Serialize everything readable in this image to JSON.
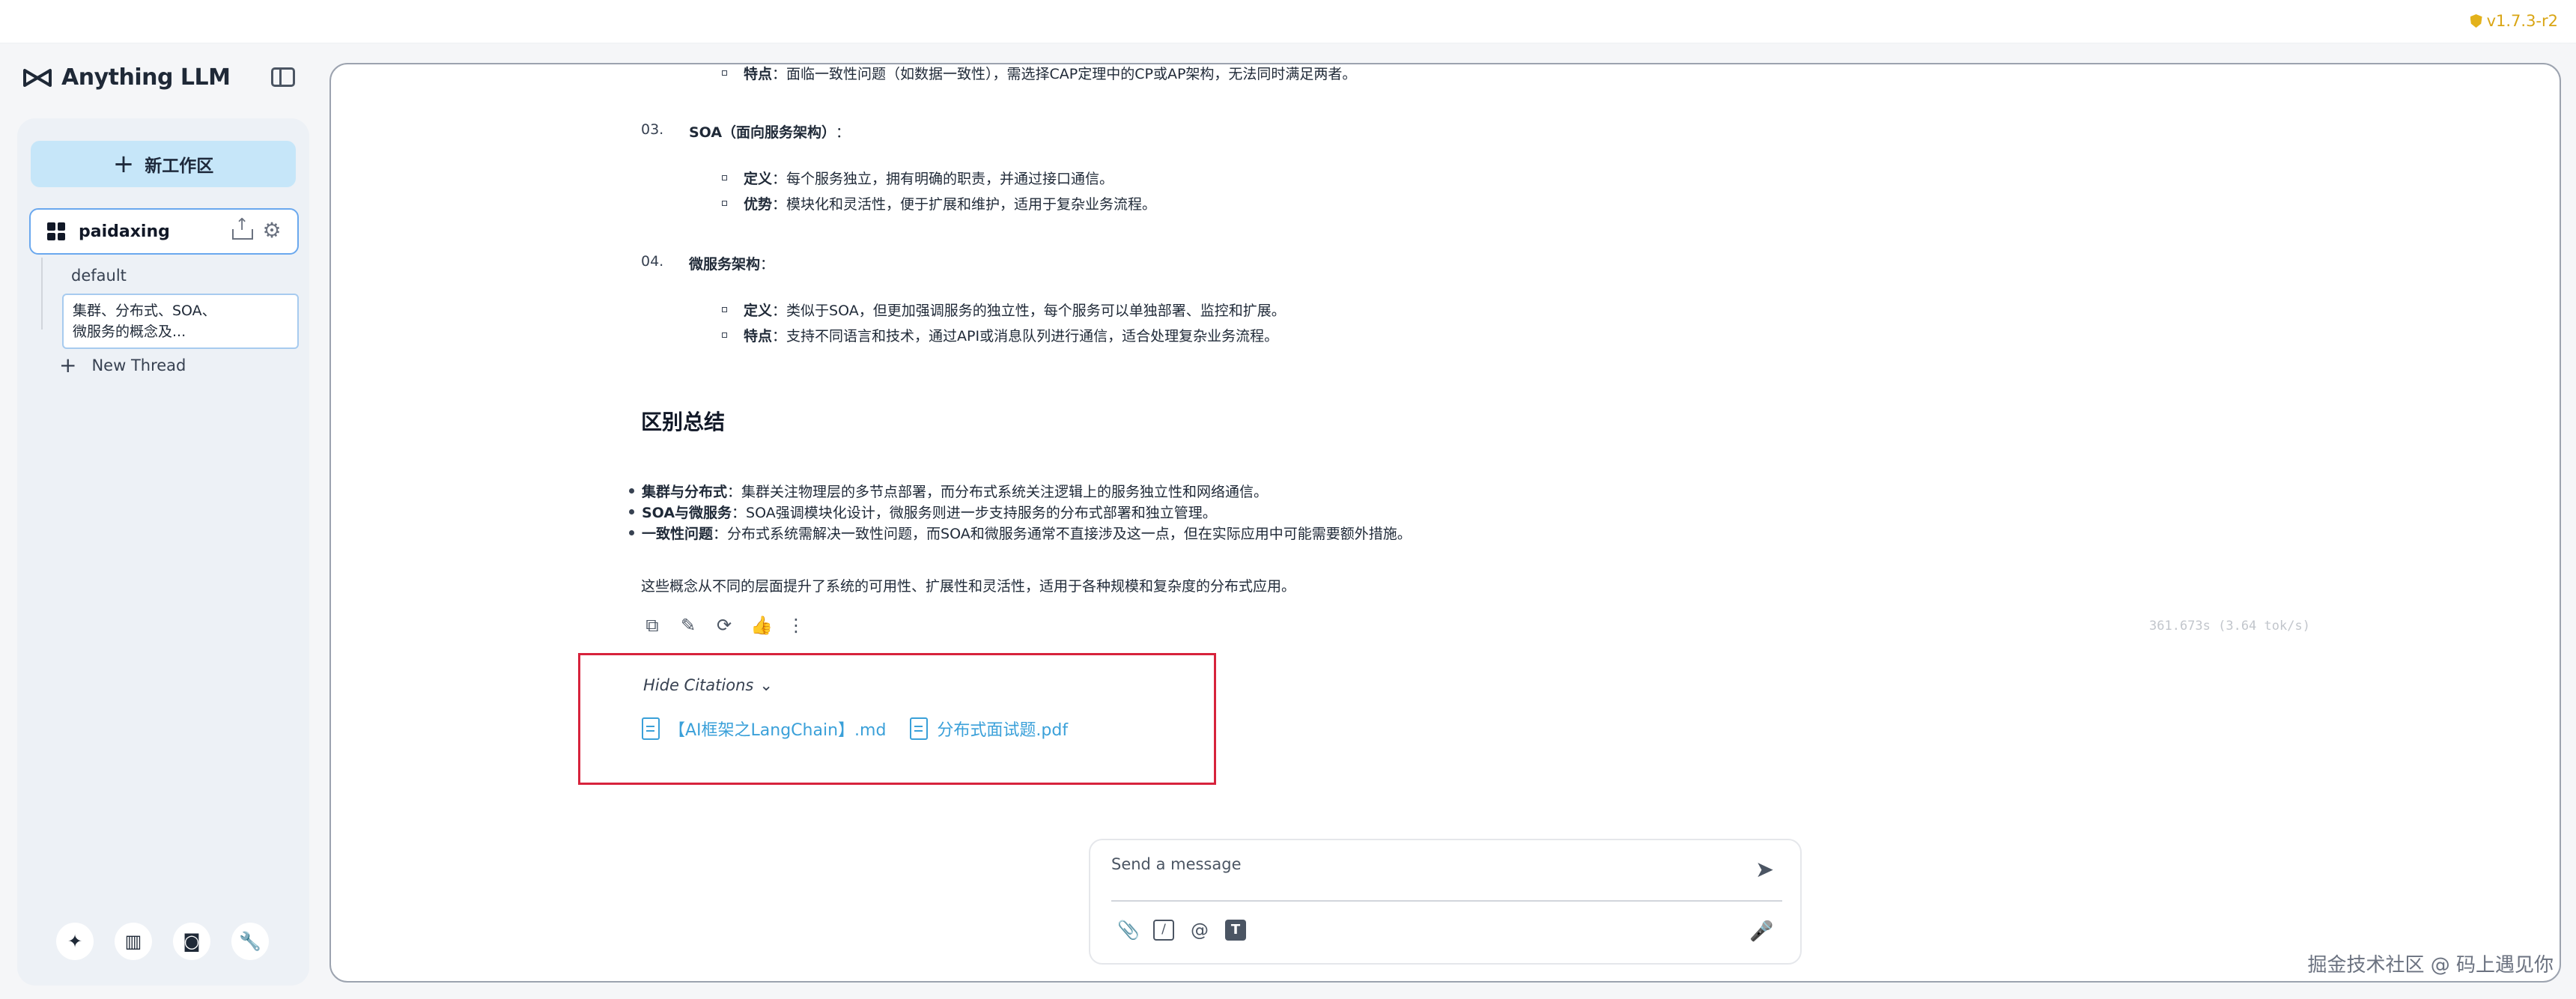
{
  "app": {
    "brand": "Anything LLM",
    "version": "v1.7.3-r2"
  },
  "sidebar": {
    "new_workspace_label": "新工作区",
    "workspace": {
      "name": "paidaxing"
    },
    "threads": [
      {
        "label": "default"
      },
      {
        "label_line1": "集群、分布式、SOA、",
        "label_line2": "微服务的概念及..."
      }
    ],
    "new_thread_label": "New Thread"
  },
  "message": {
    "top_point": {
      "label": "特点",
      "text": "：面临一致性问题（如数据一致性），需选择CAP定理中的CP或AP架构，无法同时满足两者。"
    },
    "sections": [
      {
        "num": "03.",
        "title": "SOA（面向服务架构）",
        "suffix": "：",
        "points": [
          {
            "label": "定义",
            "text": "：每个服务独立，拥有明确的职责，并通过接口通信。"
          },
          {
            "label": "优势",
            "text": "：模块化和灵活性，便于扩展和维护，适用于复杂业务流程。"
          }
        ]
      },
      {
        "num": "04.",
        "title": "微服务架构",
        "suffix": "：",
        "points": [
          {
            "label": "定义",
            "text": "：类似于SOA，但更加强调服务的独立性，每个服务可以单独部署、监控和扩展。"
          },
          {
            "label": "特点",
            "text": "：支持不同语言和技术，通过API或消息队列进行通信，适合处理复杂业务流程。"
          }
        ]
      }
    ],
    "summary_title": "区别总结",
    "summary_points": [
      {
        "label": "集群与分布式",
        "text": "：集群关注物理层的多节点部署，而分布式系统关注逻辑上的服务独立性和网络通信。"
      },
      {
        "label": "SOA与微服务",
        "text": "：SOA强调模块化设计，微服务则进一步支持服务的分布式部署和独立管理。"
      },
      {
        "label": "一致性问题",
        "text": "：分布式系统需解决一致性问题，而SOA和微服务通常不直接涉及这一点，但在实际应用中可能需要额外措施。"
      }
    ],
    "closing": "这些概念从不同的层面提升了系统的可用性、扩展性和灵活性，适用于各种规模和复杂度的分布式应用。",
    "token_speed": "361.673s (3.64 tok/s)"
  },
  "citations": {
    "toggle_label": "Hide Citations",
    "items": [
      {
        "name": "【AI框架之LangChain】.md"
      },
      {
        "name": "分布式面试题.pdf"
      }
    ]
  },
  "composer": {
    "placeholder": "Send a message"
  },
  "watermark": "掘金技术社区 @ 码上遇见你"
}
